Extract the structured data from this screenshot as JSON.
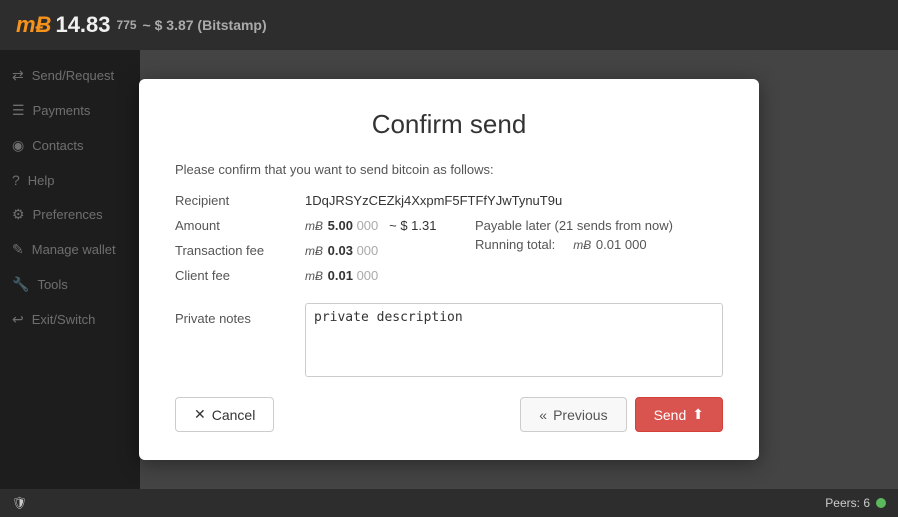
{
  "topbar": {
    "btc_symbol": "mɃ",
    "amount": "14.83",
    "subscript": "775",
    "fiat": "~ $ 3.87 (Bitstamp)"
  },
  "sidebar": {
    "items": [
      {
        "id": "send-request",
        "icon": "⇄",
        "label": "Send/Request"
      },
      {
        "id": "payments",
        "icon": "☰",
        "label": "Payments"
      },
      {
        "id": "contacts",
        "icon": "👤",
        "label": "Contacts"
      },
      {
        "id": "help",
        "icon": "?",
        "label": "Help"
      },
      {
        "id": "preferences",
        "icon": "⚙",
        "label": "Preferences"
      },
      {
        "id": "manage-wallet",
        "icon": "✎",
        "label": "Manage wallet"
      },
      {
        "id": "tools",
        "icon": "🔧",
        "label": "Tools"
      },
      {
        "id": "exit-switch",
        "icon": "↩",
        "label": "Exit/Switch"
      }
    ]
  },
  "statusbar": {
    "shield_icon": "🛡",
    "peers_label": "Peers: 6"
  },
  "modal": {
    "title": "Confirm send",
    "subtitle": "Please confirm that you want to send bitcoin as follows:",
    "recipient_label": "Recipient",
    "recipient_value": "1DqJRSYzCEZkj4XxpmF5FTFfYJwTynuT9u",
    "amount_label": "Amount",
    "amount_mbtc": "mɃ",
    "amount_bold": "5.00",
    "amount_muted": "000",
    "amount_fiat": "~ $ 1.31",
    "txfee_label": "Transaction fee",
    "txfee_mbtc": "mɃ",
    "txfee_bold": "0.03",
    "txfee_muted": "000",
    "clientfee_label": "Client fee",
    "clientfee_mbtc": "mɃ",
    "clientfee_bold": "0.01",
    "clientfee_muted": "000",
    "payable_later": "Payable later (21 sends from now)",
    "running_total_label": "Running total:",
    "running_total_mbtc": "mɃ",
    "running_total_value": "0.01",
    "running_total_muted": "000",
    "notes_label": "Private notes",
    "notes_placeholder": "private description",
    "notes_value": "private description",
    "cancel_label": "Cancel",
    "previous_label": "Previous",
    "send_label": "Send"
  }
}
